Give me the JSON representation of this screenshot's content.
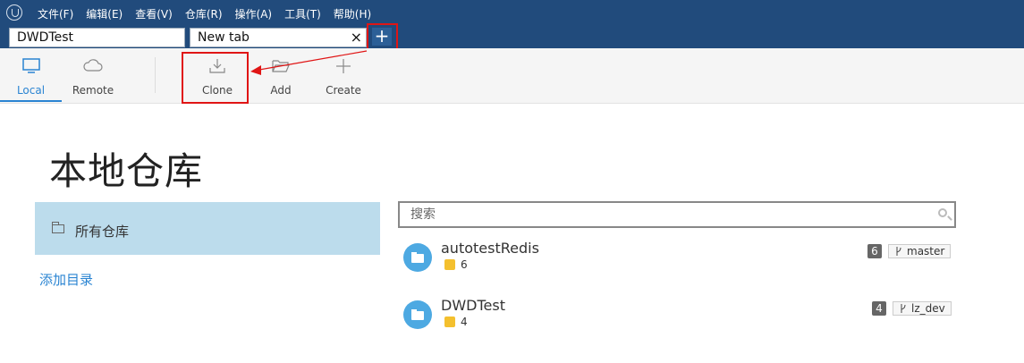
{
  "menu": [
    "文件(F)",
    "编辑(E)",
    "查看(V)",
    "仓库(R)",
    "操作(A)",
    "工具(T)",
    "帮助(H)"
  ],
  "tabs": [
    {
      "label": "DWDTest"
    },
    {
      "label": "New tab",
      "close": "×"
    }
  ],
  "new_tab_button": "+",
  "toolbar": {
    "local": "Local",
    "remote": "Remote",
    "clone": "Clone",
    "add": "Add",
    "create": "Create"
  },
  "page": {
    "title": "本地仓库",
    "all_repos": "所有仓库",
    "add_dir": "添加目录",
    "search_placeholder": "搜索"
  },
  "repos": [
    {
      "name": "autotestRedis",
      "count": "6",
      "badge": "6",
      "branch": "master"
    },
    {
      "name": "DWDTest",
      "count": "4",
      "badge": "4",
      "branch": "lz_dev"
    }
  ],
  "colors": {
    "titlebar": "#214b7c",
    "accent": "#2a84d2",
    "highlight_box": "#e01515",
    "selected_panel": "#bcdcec",
    "repo_icon": "#4da9e2"
  }
}
